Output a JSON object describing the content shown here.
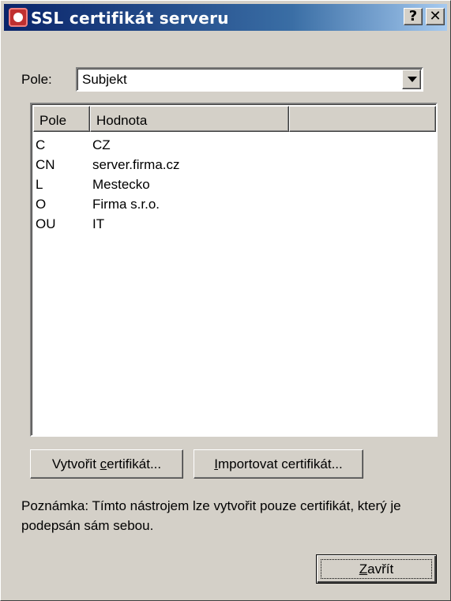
{
  "window": {
    "title": "SSL certifikát serveru",
    "help_glyph": "?",
    "close_glyph": "✕"
  },
  "field": {
    "label": "Pole:",
    "selected": "Subjekt"
  },
  "table": {
    "columns": [
      "Pole",
      "Hodnota",
      ""
    ],
    "rows": [
      {
        "field": "C",
        "value": "CZ"
      },
      {
        "field": "CN",
        "value": "server.firma.cz"
      },
      {
        "field": "L",
        "value": "Mestecko"
      },
      {
        "field": "O",
        "value": "Firma s.r.o."
      },
      {
        "field": "OU",
        "value": "IT"
      }
    ]
  },
  "buttons": {
    "create": {
      "pre": "Vytvořit ",
      "access": "c",
      "post": "ertifikát..."
    },
    "import": {
      "pre": "",
      "access": "I",
      "post": "mportovat certifikát..."
    },
    "close": {
      "pre": "",
      "access": "Z",
      "post": "avřít"
    }
  },
  "note": "Poznámka: Tímto nástrojem lze vytvořit pouze certifikát, který je podepsán sám sebou."
}
